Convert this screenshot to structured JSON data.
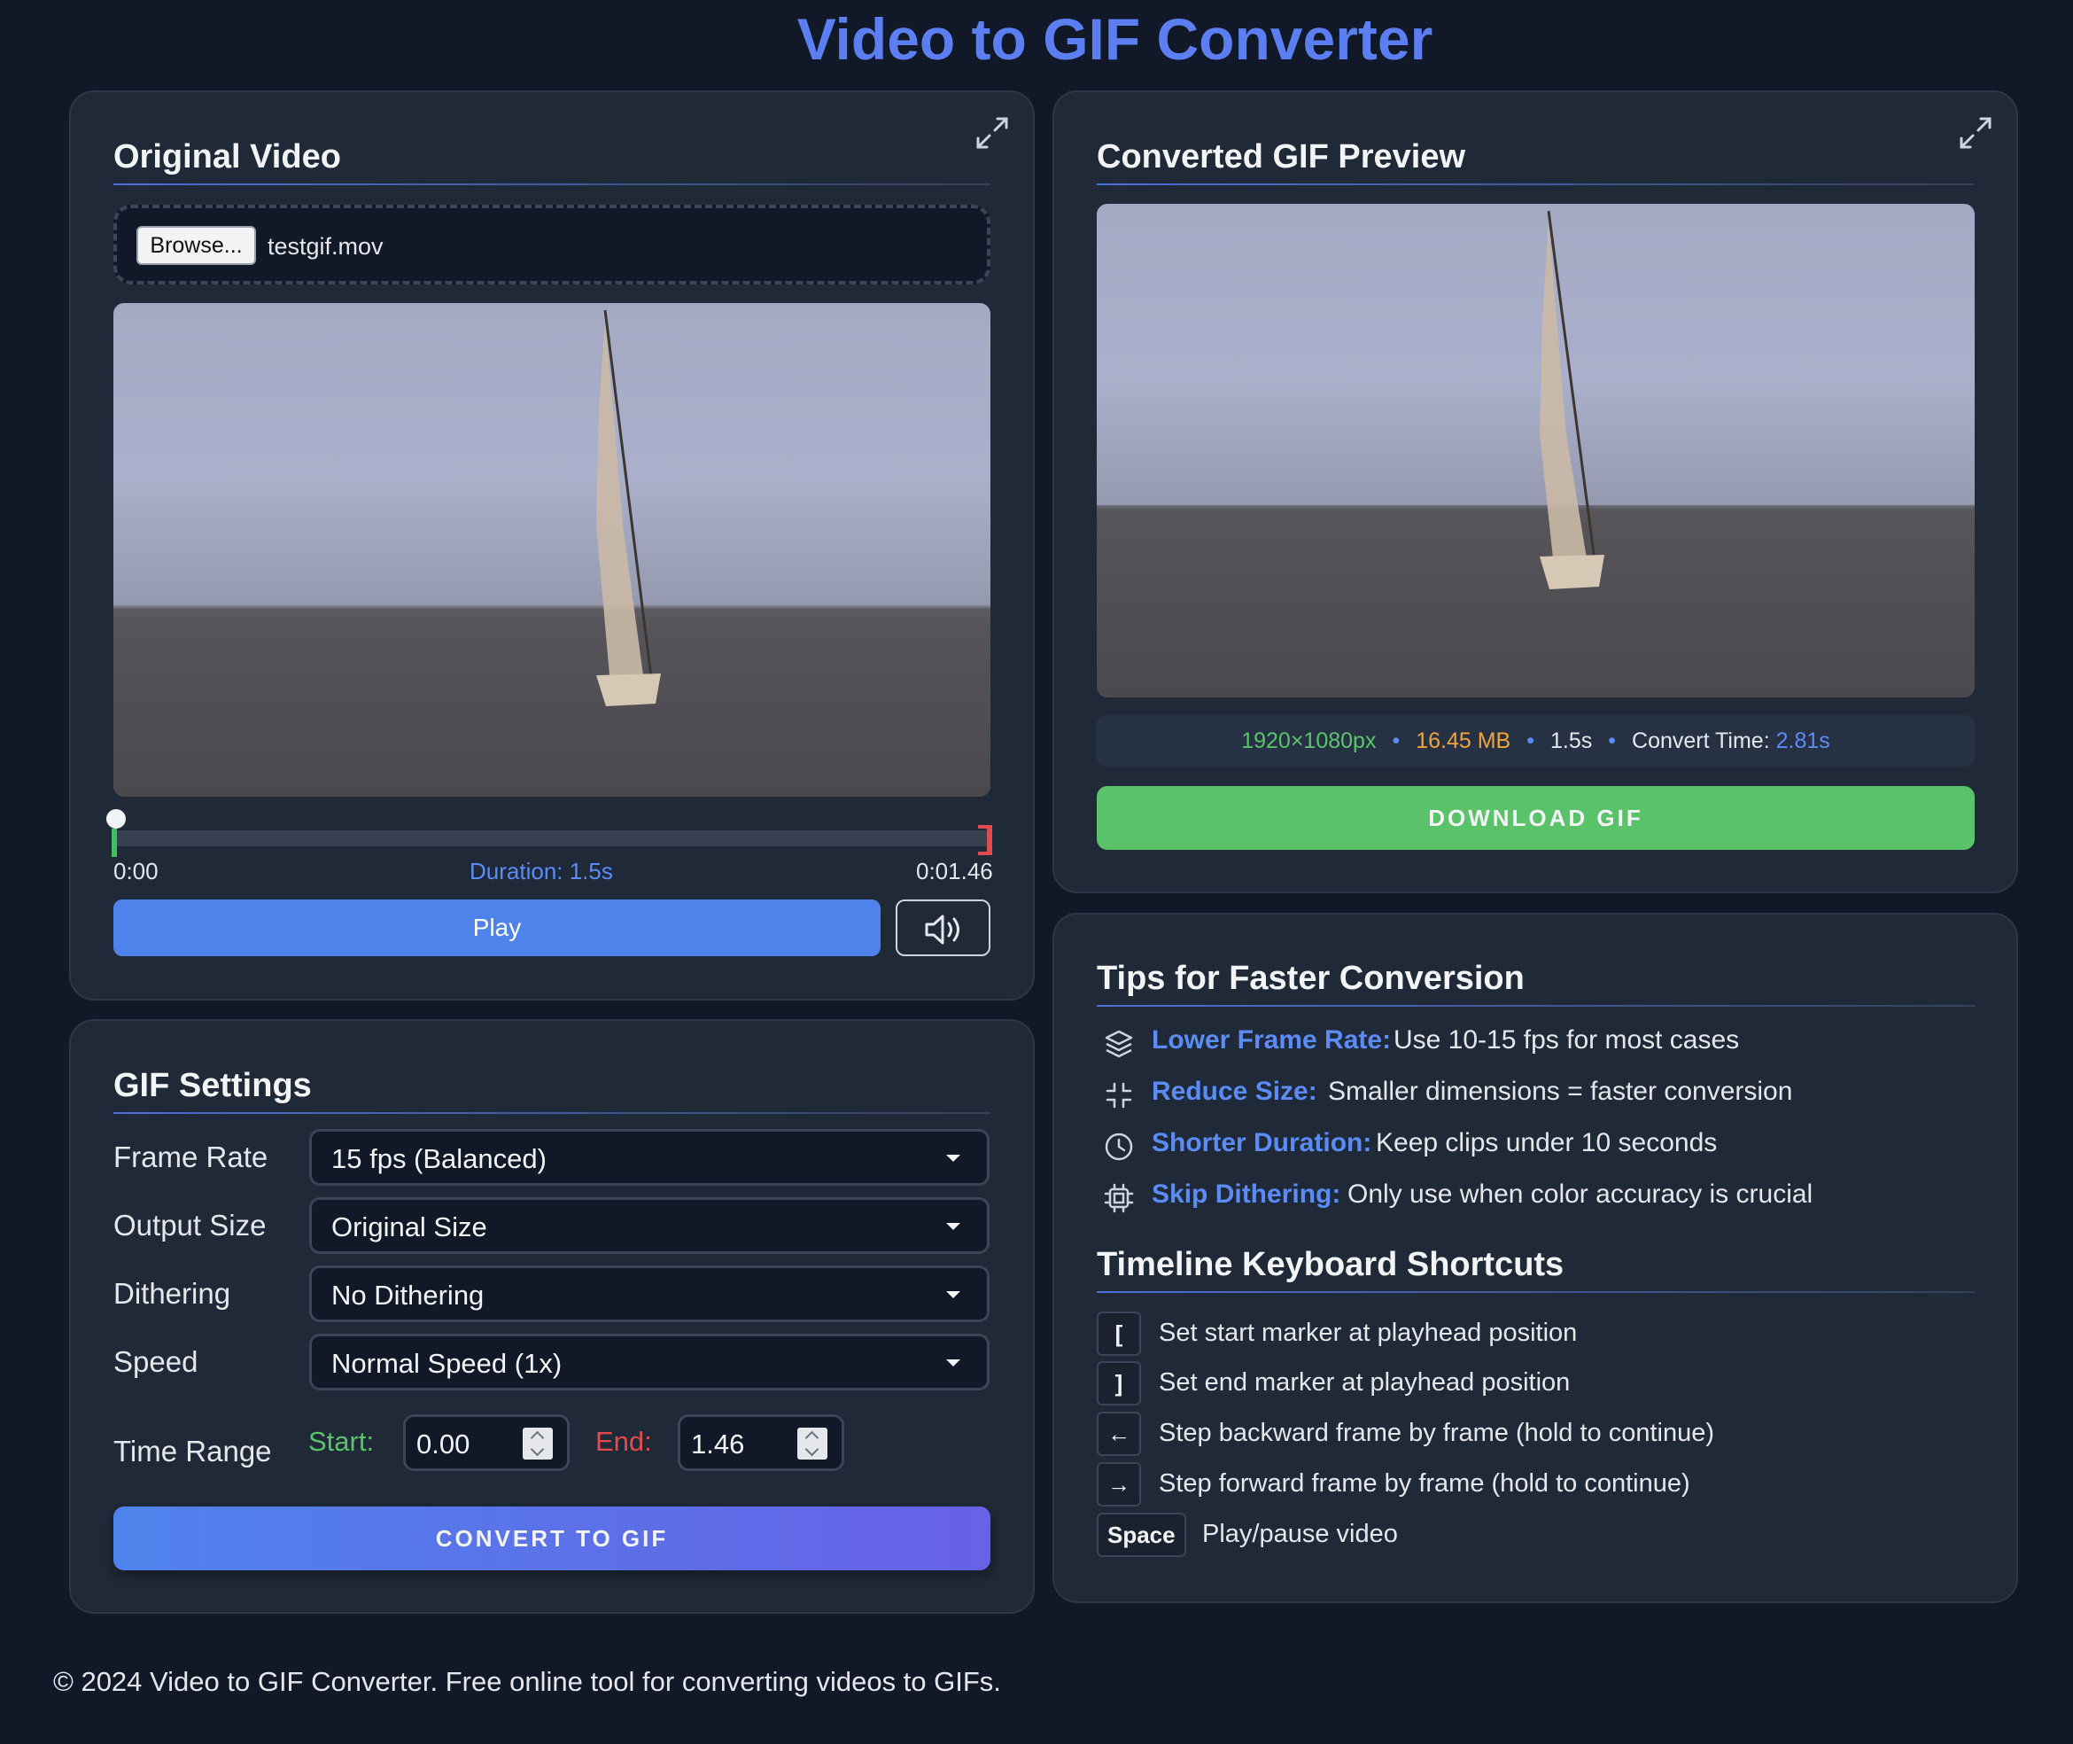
{
  "app": {
    "title": "Video to GIF Converter"
  },
  "original": {
    "title": "Original Video",
    "browse_label": "Browse...",
    "file_name": "testgif.mov",
    "time_start": "0:00",
    "duration": "Duration: 1.5s",
    "time_end": "0:01.46",
    "play_label": "Play"
  },
  "settings": {
    "title": "GIF Settings",
    "frame_rate": {
      "label": "Frame Rate",
      "value": "15 fps (Balanced)"
    },
    "output_size": {
      "label": "Output Size",
      "value": "Original Size"
    },
    "dithering": {
      "label": "Dithering",
      "value": "No Dithering"
    },
    "speed": {
      "label": "Speed",
      "value": "Normal Speed (1x)"
    },
    "time_range": {
      "label": "Time Range",
      "start_label": "Start:",
      "start_value": "0.00",
      "end_label": "End:",
      "end_value": "1.46"
    },
    "convert_label": "CONVERT TO GIF"
  },
  "preview": {
    "title": "Converted GIF Preview",
    "resolution": "1920×1080px",
    "file_size": "16.45 MB",
    "duration": "1.5s",
    "convert_time_label": "Convert Time:",
    "convert_time_value": "2.81s",
    "download_label": "DOWNLOAD GIF"
  },
  "tips": {
    "title": "Tips for Faster Conversion",
    "items": [
      {
        "icon": "layers-icon",
        "title": "Lower Frame Rate:",
        "text": "Use 10-15 fps for most cases"
      },
      {
        "icon": "minimize-icon",
        "title": "Reduce Size:",
        "text": "Smaller dimensions = faster conversion"
      },
      {
        "icon": "clock-icon",
        "title": "Shorter Duration:",
        "text": "Keep clips under 10 seconds"
      },
      {
        "icon": "chip-icon",
        "title": "Skip Dithering:",
        "text": "Only use when color accuracy is crucial"
      }
    ]
  },
  "shortcuts": {
    "title": "Timeline Keyboard Shortcuts",
    "items": [
      {
        "key": "[",
        "desc": "Set start marker at playhead position"
      },
      {
        "key": "]",
        "desc": "Set end marker at playhead position"
      },
      {
        "key": "←",
        "desc": "Step backward frame by frame (hold to continue)"
      },
      {
        "key": "→",
        "desc": "Step forward frame by frame (hold to continue)"
      },
      {
        "key": "Space",
        "desc": "Play/pause video"
      }
    ]
  },
  "footer": {
    "text": "© 2024 Video to GIF Converter. Free online tool for converting videos to GIFs."
  },
  "colors": {
    "background": "#111827",
    "card": "#1f2937",
    "accent_blue": "#4f83ec",
    "accent_green": "#5ac36a",
    "resolution_green": "#5ac36a",
    "size_orange": "#f0a43a",
    "end_red": "#e04b4b"
  }
}
